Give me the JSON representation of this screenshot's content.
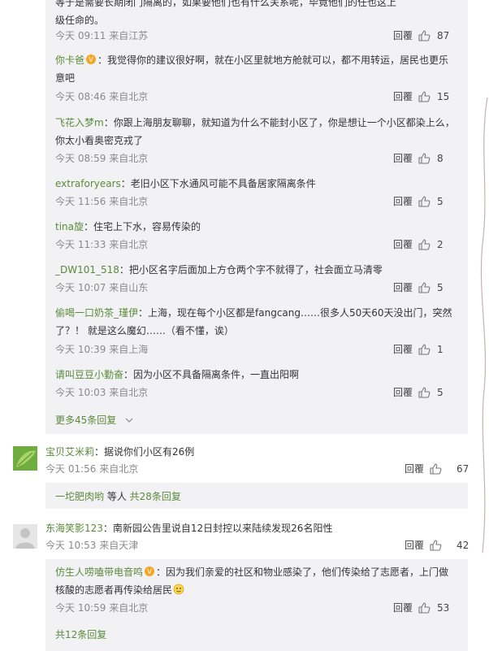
{
  "reply_label": "回覆",
  "nested_top": [
    {
      "text": "等于是需要长期闭门隔离的，如果要他们也有什么关系呢，毕竟他们的任也这上",
      "text2": "级任命的。",
      "meta": "今天 09:11 来自江苏",
      "likes": "87"
    },
    {
      "name": "你卡爸",
      "text": "：我觉得你的建议很好啊，就在小区里就地方舱就可以，都不用转运，居民也更乐",
      "text2": "意吧",
      "meta": "今天 08:46 来自北京",
      "likes": "15"
    },
    {
      "name": "飞花入梦m",
      "text": "：你跟上海朋友聊聊，就知道为什么不能封小区了，你是想让一个小区都染上么，",
      "text2": "你太小看奥密克戎了",
      "meta": "今天 08:59 来自北京",
      "likes": "8"
    },
    {
      "name": "extraforyears",
      "text": "：老旧小区下水通风可能不具备居家隔离条件",
      "meta": "今天 11:56 来自北京",
      "likes": "5"
    },
    {
      "name": "tina旋",
      "text": "：住宅上下水，容易传染的",
      "meta": "今天 11:33 来自北京",
      "likes": "2"
    },
    {
      "name": "_DW101_518",
      "text": "：把小区名字后面加上方仓两个字不就得了，社会面立马清零",
      "meta": "今天 10:07 来自山东",
      "likes": "5"
    },
    {
      "name": "偷喝一口奶茶_瑾伊",
      "text": "：上海，现在每个小区都是fangcang……很多人50天60天没出门，突然",
      "text2": "了？！ 就是这么魔幻……（看不懂，诶）",
      "meta": "今天 10:39 来自上海",
      "likes": "1"
    },
    {
      "name": "请叫豆豆小勤奋",
      "text": "：因为小区不具备隔离条件，一直出阳啊",
      "meta": "今天 10:03 来自北京",
      "likes": "5"
    }
  ],
  "more_replies_1": "更多45条回复",
  "comment_a": {
    "name": "宝贝艾米莉",
    "text": "：据说你们小区有26例",
    "meta": "今天 01:56 来自北京",
    "likes": "67",
    "sub_link": "一坨肥肉哟",
    "sub_mid": " 等人 ",
    "sub_count": "共28条回复"
  },
  "comment_b": {
    "name": "东海笑影123",
    "text": "：南新园公告里说自12日封控以来陆续发现26名阳性",
    "meta": "今天 10:53 来自天津",
    "likes": "42"
  },
  "reply_b1": {
    "name": "仿生人唠嗑带电音鸣",
    "text": "：因为我们亲爱的社区和物业感染了，他们传染给了志愿者，上门做",
    "text2": "核酸的志愿者再传染给居民",
    "meta": "今天 10:59 来自北京",
    "likes": "53"
  },
  "more_replies_2": "共12条回复"
}
